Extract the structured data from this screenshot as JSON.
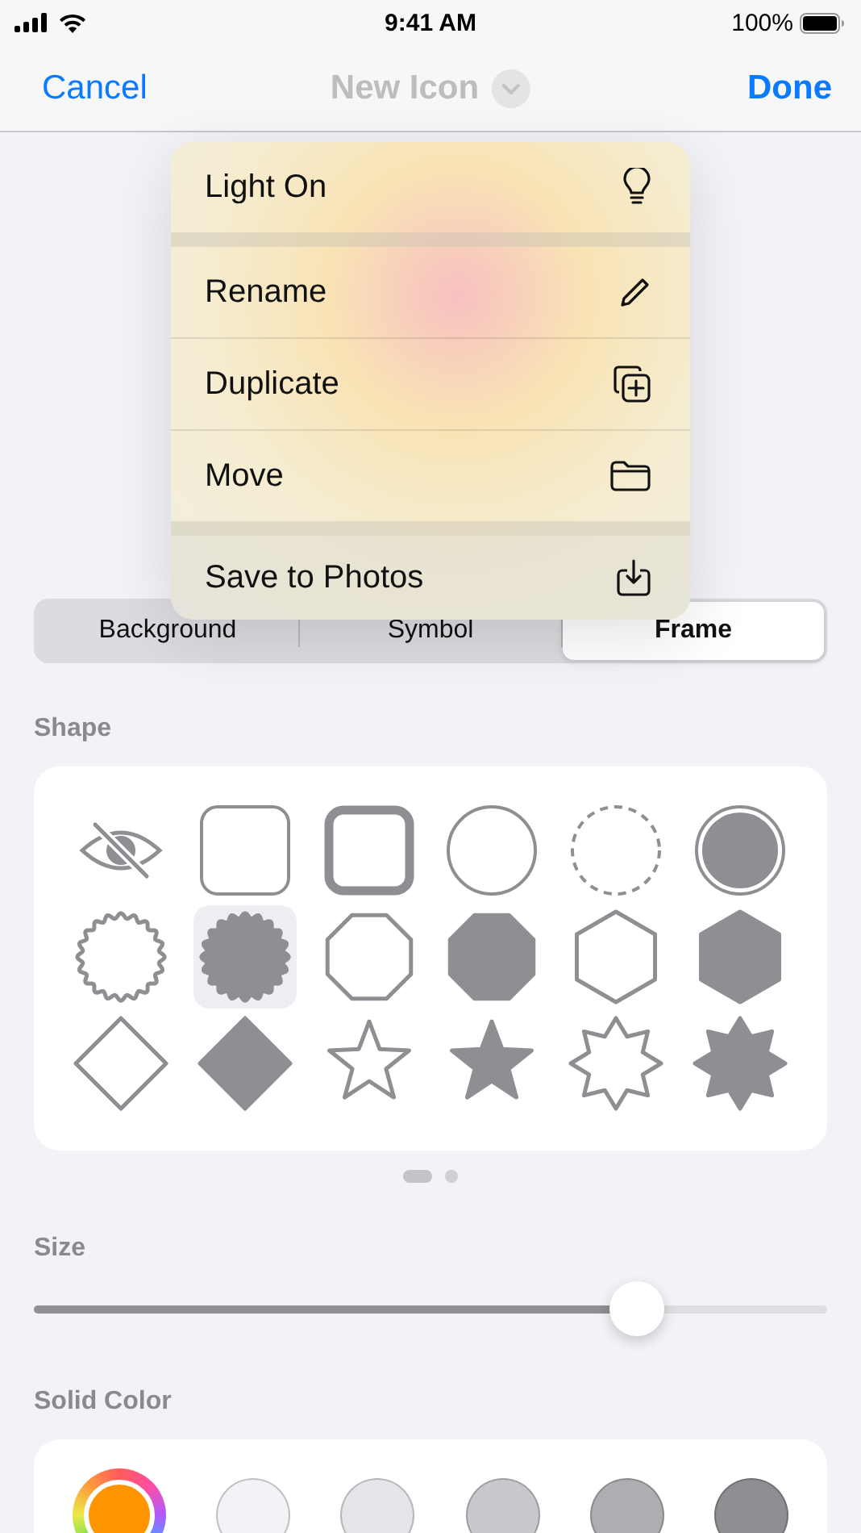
{
  "status_bar": {
    "time": "9:41 AM",
    "battery": "100%"
  },
  "nav": {
    "cancel": "Cancel",
    "title": "New Icon",
    "title_disabled": true,
    "done": "Done"
  },
  "menu": {
    "sections": [
      [
        {
          "label": "Light On"
        }
      ],
      [
        {
          "label": "Rename"
        },
        {
          "label": "Duplicate"
        },
        {
          "label": "Move"
        }
      ],
      [
        {
          "label": "Save to Photos"
        }
      ]
    ]
  },
  "segments": [
    {
      "label": "Background",
      "selected": false
    },
    {
      "label": "Symbol",
      "selected": false
    },
    {
      "label": "Frame",
      "selected": true
    }
  ],
  "shape_section": {
    "title": "Shape",
    "shapes": [
      {
        "kind": "eye",
        "filled": true,
        "selected": false
      },
      {
        "kind": "square",
        "filled": false,
        "selected": false
      },
      {
        "kind": "thick-square",
        "filled": false,
        "selected": false
      },
      {
        "kind": "circle",
        "filled": false,
        "selected": false
      },
      {
        "kind": "dashed-circle",
        "filled": false,
        "selected": false
      },
      {
        "kind": "ringed-circle",
        "filled": true,
        "selected": false
      },
      {
        "kind": "scallop",
        "filled": false,
        "selected": false
      },
      {
        "kind": "scallop",
        "filled": true,
        "selected": true
      },
      {
        "kind": "octagon",
        "filled": false,
        "selected": false
      },
      {
        "kind": "octagon",
        "filled": true,
        "selected": false
      },
      {
        "kind": "hexagon",
        "filled": false,
        "selected": false
      },
      {
        "kind": "hexagon",
        "filled": true,
        "selected": false
      },
      {
        "kind": "diamond",
        "filled": false,
        "selected": false
      },
      {
        "kind": "diamond",
        "filled": true,
        "selected": false
      },
      {
        "kind": "star",
        "filled": false,
        "selected": false
      },
      {
        "kind": "star",
        "filled": true,
        "selected": false
      },
      {
        "kind": "burst",
        "filled": false,
        "selected": false
      },
      {
        "kind": "burst",
        "filled": true,
        "selected": false
      }
    ],
    "pages": [
      {
        "selected": true
      },
      {
        "selected": false
      }
    ]
  },
  "size": {
    "title": "Size",
    "level": 0.76
  },
  "solid_color": {
    "title": "Solid Color",
    "swatches": [
      {
        "kind": "picker",
        "color": "#ff9500"
      },
      {
        "kind": "solid",
        "color": "#f2f2f7"
      },
      {
        "kind": "solid",
        "color": "#e5e5ea"
      },
      {
        "kind": "solid",
        "color": "#c7c7cc"
      },
      {
        "kind": "solid",
        "color": "#aeaeb2"
      },
      {
        "kind": "solid",
        "color": "#8e8e93"
      }
    ]
  }
}
